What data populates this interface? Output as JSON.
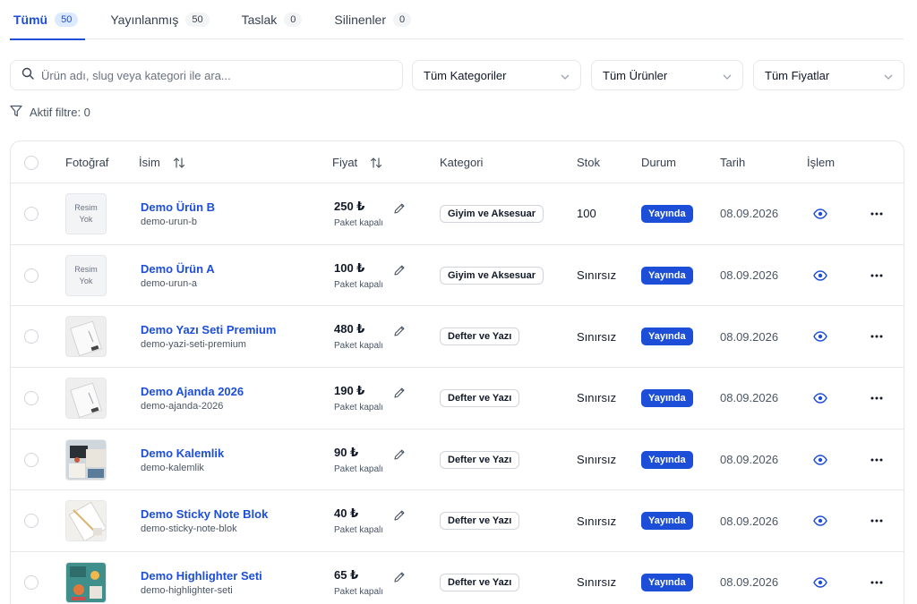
{
  "tabs": [
    {
      "label": "Tümü",
      "count": "50",
      "active": true
    },
    {
      "label": "Yayınlanmış",
      "count": "50",
      "active": false
    },
    {
      "label": "Taslak",
      "count": "0",
      "active": false
    },
    {
      "label": "Silinenler",
      "count": "0",
      "active": false
    }
  ],
  "filters": {
    "search_placeholder": "Ürün adı, slug veya kategori ile ara...",
    "category": "Tüm Kategoriler",
    "products": "Tüm Ürünler",
    "prices": "Tüm Fiyatlar",
    "active_filter": "Aktif filtre: 0"
  },
  "table": {
    "headers": {
      "photo": "Fotoğraf",
      "name": "İsim",
      "price": "Fiyat",
      "category": "Kategori",
      "stock": "Stok",
      "status": "Durum",
      "date": "Tarih",
      "action": "İşlem"
    },
    "no_image_text": "Resim Yok",
    "rows": [
      {
        "name": "Demo Ürün B",
        "slug": "demo-urun-b",
        "price": "250 ₺",
        "price_note": "Paket kapalı",
        "category": "Giyim ve Aksesuar",
        "stock": "100",
        "status": "Yayında",
        "date": "08.09.2026",
        "image": "none"
      },
      {
        "name": "Demo Ürün A",
        "slug": "demo-urun-a",
        "price": "100 ₺",
        "price_note": "Paket kapalı",
        "category": "Giyim ve Aksesuar",
        "stock": "Sınırsız",
        "status": "Yayında",
        "date": "08.09.2026",
        "image": "none"
      },
      {
        "name": "Demo Yazı Seti Premium",
        "slug": "demo-yazi-seti-premium",
        "price": "480 ₺",
        "price_note": "Paket kapalı",
        "category": "Defter ve Yazı",
        "stock": "Sınırsız",
        "status": "Yayında",
        "date": "08.09.2026",
        "image": "notebook"
      },
      {
        "name": "Demo Ajanda 2026",
        "slug": "demo-ajanda-2026",
        "price": "190 ₺",
        "price_note": "Paket kapalı",
        "category": "Defter ve Yazı",
        "stock": "Sınırsız",
        "status": "Yayında",
        "date": "08.09.2026",
        "image": "notebook"
      },
      {
        "name": "Demo Kalemlik",
        "slug": "demo-kalemlik",
        "price": "90 ₺",
        "price_note": "Paket kapalı",
        "category": "Defter ve Yazı",
        "stock": "Sınırsız",
        "status": "Yayında",
        "date": "08.09.2026",
        "image": "desk"
      },
      {
        "name": "Demo Sticky Note Blok",
        "slug": "demo-sticky-note-blok",
        "price": "40 ₺",
        "price_note": "Paket kapalı",
        "category": "Defter ve Yazı",
        "stock": "Sınırsız",
        "status": "Yayında",
        "date": "08.09.2026",
        "image": "paper"
      },
      {
        "name": "Demo Highlighter Seti",
        "slug": "demo-highlighter-seti",
        "price": "65 ₺",
        "price_note": "Paket kapalı",
        "category": "Defter ve Yazı",
        "stock": "Sınırsız",
        "status": "Yayında",
        "date": "08.09.2026",
        "image": "teal"
      }
    ]
  },
  "colors": {
    "accent": "#1d4ed8",
    "border": "#e5e7eb"
  }
}
